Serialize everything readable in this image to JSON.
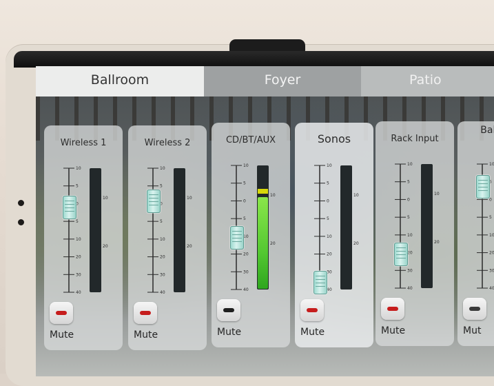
{
  "tabs": [
    {
      "label": "Ballroom",
      "active": false
    },
    {
      "label": "Foyer",
      "active": true
    },
    {
      "label": "Patio",
      "active": false
    }
  ],
  "channels": [
    {
      "label": "Wireless 1",
      "fader_level": 0.69,
      "meter_level": 0,
      "peak_level": 0,
      "mute_label": "Mute",
      "muted": true,
      "led_color": "#c61d1d"
    },
    {
      "label": "Wireless 2",
      "fader_level": 0.74,
      "meter_level": 0,
      "peak_level": 0,
      "mute_label": "Mute",
      "muted": true,
      "led_color": "#c61d1d"
    },
    {
      "label": "CD/BT/AUX",
      "fader_level": 0.42,
      "meter_level": 0.75,
      "peak_level": 0.78,
      "mute_label": "Mute",
      "muted": false,
      "led_color": "#1f1f1f"
    },
    {
      "label": "Sonos",
      "fader_level": 0.06,
      "meter_level": 0,
      "peak_level": 0,
      "mute_label": "Mute",
      "muted": true,
      "led_color": "#c61d1d"
    },
    {
      "label": "Rack Input",
      "fader_level": 0.28,
      "meter_level": 0,
      "peak_level": 0,
      "mute_label": "Mute",
      "muted": true,
      "led_color": "#c61d1d"
    },
    {
      "label": "Ball Vo",
      "fader_level": 0.82,
      "meter_level": 0,
      "peak_level": 0,
      "mute_label": "Mut",
      "muted": false,
      "led_color": "#3a3a3a"
    }
  ],
  "fader_scale_ticks": [
    "10",
    "5",
    "0",
    "5",
    "10",
    "20",
    "30",
    "40"
  ],
  "meter_scale_ticks": [
    "10",
    "20"
  ],
  "colors": {
    "meter_green": "#54c832",
    "meter_peak": "#d7d80a",
    "mute_led": "#c61d1d",
    "fader_cap": "#c8ece6"
  }
}
